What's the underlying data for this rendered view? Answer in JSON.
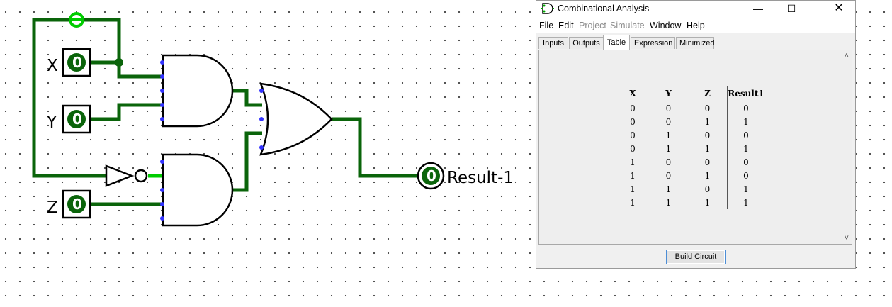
{
  "circuit": {
    "inputs": [
      {
        "name": "X",
        "value": "0"
      },
      {
        "name": "Y",
        "value": "0"
      },
      {
        "name": "Z",
        "value": "0"
      }
    ],
    "output": {
      "name": "Result-1",
      "value": "0"
    }
  },
  "window": {
    "title": "Combinational Analysis",
    "menu": [
      "File",
      "Edit",
      "Project",
      "Simulate",
      "Window",
      "Help"
    ],
    "menu_disabled": [
      "Project",
      "Simulate"
    ],
    "tabs": [
      "Inputs",
      "Outputs",
      "Table",
      "Expression",
      "Minimized"
    ],
    "active_tab": "Table",
    "table": {
      "headers": [
        "X",
        "Y",
        "Z",
        "Result1"
      ],
      "rows": [
        [
          "0",
          "0",
          "0",
          "0"
        ],
        [
          "0",
          "0",
          "1",
          "1"
        ],
        [
          "0",
          "1",
          "0",
          "0"
        ],
        [
          "0",
          "1",
          "1",
          "1"
        ],
        [
          "1",
          "0",
          "0",
          "0"
        ],
        [
          "1",
          "0",
          "1",
          "0"
        ],
        [
          "1",
          "1",
          "0",
          "1"
        ],
        [
          "1",
          "1",
          "1",
          "1"
        ]
      ]
    },
    "build_button_label": "Build Circuit"
  },
  "colors": {
    "wire_active": "#00aa00",
    "wire_dark": "#006400",
    "pin_fill": "#006400",
    "port_dot": "#3333ff"
  }
}
